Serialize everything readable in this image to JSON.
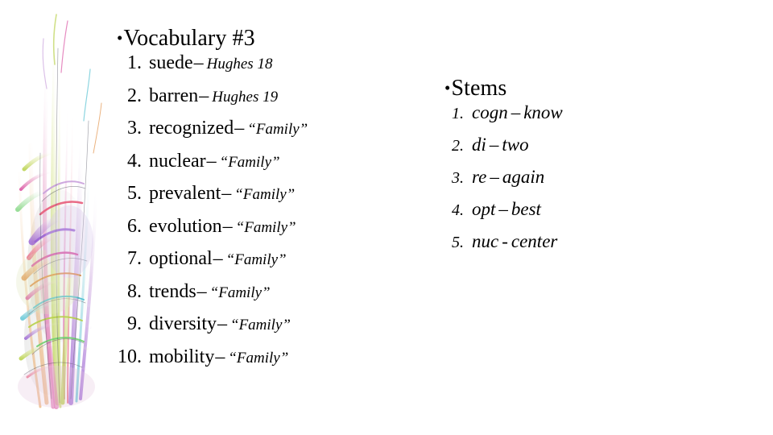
{
  "slide": {
    "background_color": "#ffffff",
    "text_color": "#000000"
  },
  "vocabulary": {
    "bullet": "•",
    "heading": "Vocabulary #3",
    "items": [
      {
        "num": "1.",
        "term": "suede",
        "dash": "–",
        "def": "Hughes 18"
      },
      {
        "num": "2.",
        "term": "barren",
        "dash": "–",
        "def": "Hughes 19"
      },
      {
        "num": "3.",
        "term": "recognized",
        "dash": "–",
        "def": "“Family”"
      },
      {
        "num": "4.",
        "term": "nuclear",
        "dash": "–",
        "def": "“Family”"
      },
      {
        "num": "5.",
        "term": "prevalent",
        "dash": "–",
        "def": "“Family”"
      },
      {
        "num": "6.",
        "term": "evolution",
        "dash": "–",
        "def": "“Family”"
      },
      {
        "num": "7.",
        "term": "optional",
        "dash": "–",
        "def": "“Family”"
      },
      {
        "num": "8.",
        "term": "trends",
        "dash": "–",
        "def": "“Family”"
      },
      {
        "num": "9.",
        "term": "diversity",
        "dash": "–",
        "def": "“Family”"
      },
      {
        "num": "10.",
        "term": "mobility",
        "dash": "–",
        "def": "“Family”"
      }
    ]
  },
  "stems": {
    "bullet": "•",
    "heading": "Stems",
    "items": [
      {
        "num": "1.",
        "stem": "cogn",
        "dash": "–",
        "meaning": "know"
      },
      {
        "num": "2.",
        "stem": "di",
        "dash": "–",
        "meaning": "two"
      },
      {
        "num": "3.",
        "stem": "re",
        "dash": "–",
        "meaning": "again"
      },
      {
        "num": "4.",
        "stem": "opt",
        "dash": "–",
        "meaning": "best"
      },
      {
        "num": "5.",
        "stem": "nuc",
        "dash": "-",
        "meaning": "center"
      }
    ]
  },
  "artwork": {
    "name": "abstract-feather-brush-strokes",
    "palette": [
      "#d94fa0",
      "#b8d14a",
      "#9a63d4",
      "#e08a3c",
      "#4fbfd0",
      "#e85d7a",
      "#6fd06f",
      "#c9a0dc"
    ]
  }
}
